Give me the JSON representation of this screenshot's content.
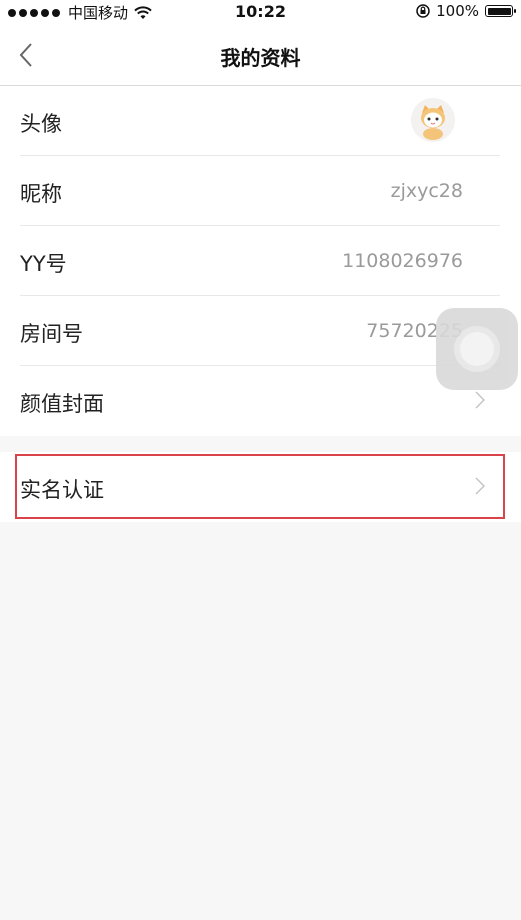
{
  "status_bar": {
    "carrier": "中国移动",
    "time": "10:22",
    "battery": "100%",
    "icons": [
      "signal-dots-icon",
      "wifi-icon",
      "orientation-lock-icon",
      "battery-icon"
    ]
  },
  "nav": {
    "title": "我的资料",
    "back_icon": "chevron-left-icon"
  },
  "profile": {
    "avatar_label": "头像",
    "nickname_label": "昵称",
    "nickname_value": "zjxyc28",
    "yy_label": "YY号",
    "yy_value": "1108026976",
    "room_label": "房间号",
    "room_value": "75720225",
    "cover_label": "颜值封面"
  },
  "verification": {
    "label": "实名认证"
  },
  "colors": {
    "highlight": "#d9434a",
    "background": "#f7f7f7",
    "value_text": "#9a9a9a"
  }
}
